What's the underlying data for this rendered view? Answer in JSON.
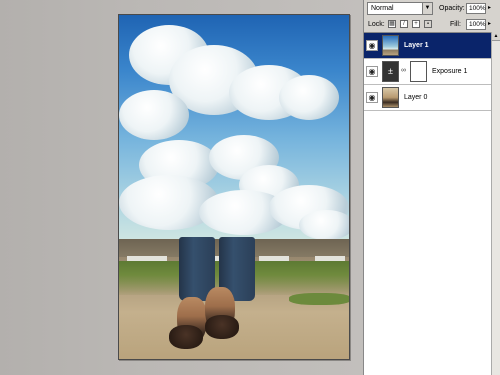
{
  "layers_panel": {
    "blend_mode": "Normal",
    "opacity_label": "Opacity:",
    "opacity_value": "100%",
    "lock_label": "Lock:",
    "fill_label": "Fill:",
    "fill_value": "100%",
    "layers": [
      {
        "name": "Layer 1",
        "selected": true
      },
      {
        "name": "Exposure 1",
        "selected": false
      },
      {
        "name": "Layer 0",
        "selected": false
      }
    ]
  },
  "icons": {
    "visibility": "eye-icon",
    "dropdown": "chevron-down-icon",
    "lock_transparency": "checker-icon",
    "lock_image": "brush-icon",
    "lock_position": "move-icon",
    "lock_all": "lock-icon",
    "adjustment": "plus-minus-icon",
    "chain": "chain-icon"
  },
  "colors": {
    "selection": "#0a246a",
    "panel_bg": "#d6d3ce",
    "workspace_bg": "#b8b4b0"
  }
}
